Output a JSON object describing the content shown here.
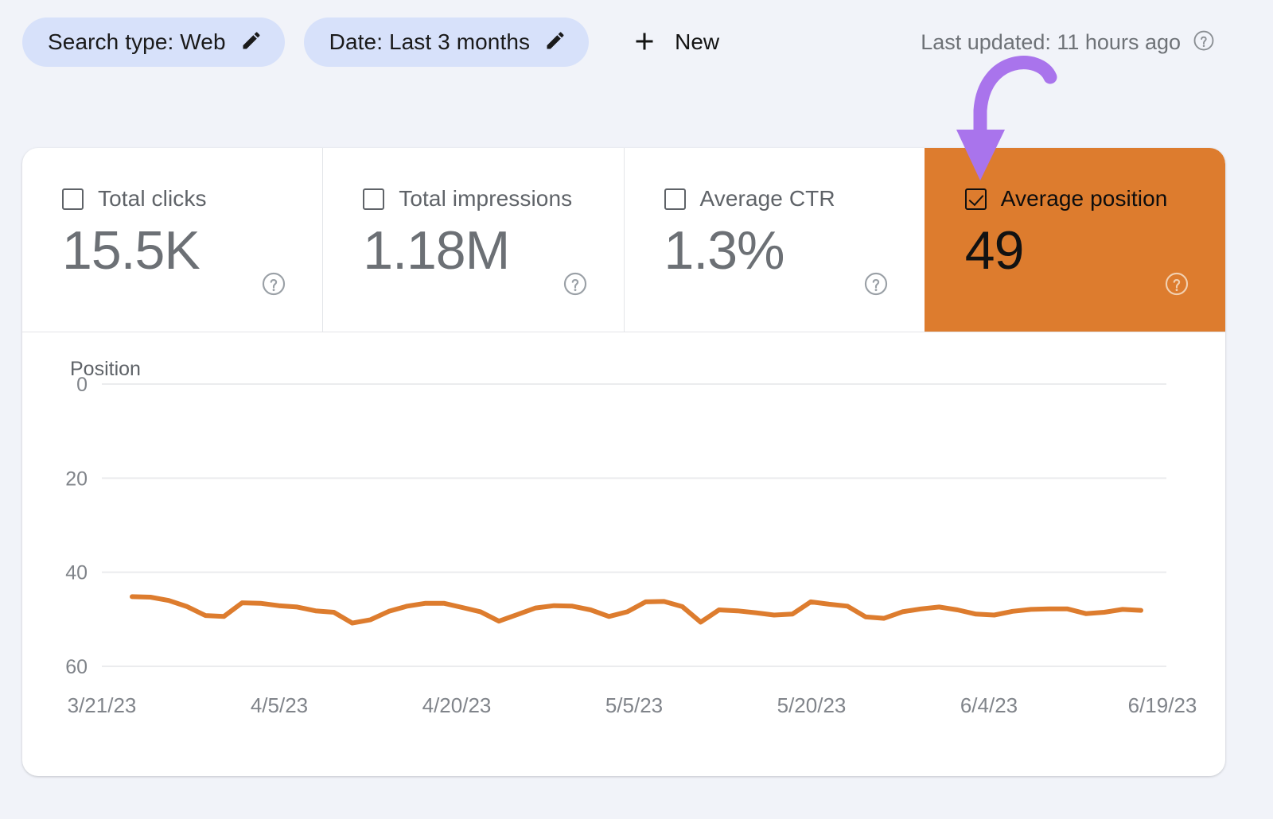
{
  "toolbar": {
    "search_type_chip": "Search type: Web",
    "date_chip": "Date: Last 3 months",
    "new_label": "New",
    "last_updated": "Last updated: 11 hours ago",
    "pencil_icon": "pencil-icon",
    "plus_icon": "plus-icon",
    "help_icon": "help-circle-icon"
  },
  "metrics": [
    {
      "label": "Total clicks",
      "value": "15.5K",
      "checked": false,
      "selected": false
    },
    {
      "label": "Total impressions",
      "value": "1.18M",
      "checked": false,
      "selected": false
    },
    {
      "label": "Average CTR",
      "value": "1.3%",
      "checked": false,
      "selected": false
    },
    {
      "label": "Average position",
      "value": "49",
      "checked": true,
      "selected": true
    }
  ],
  "annotation": {
    "type": "curved-down-arrow",
    "color": "#A974EC",
    "points_to": "Average position"
  },
  "colors": {
    "accent_orange": "#DD7C2E",
    "chip_blue": "#D7E1FA",
    "page_background": "#F1F3F9",
    "card_background": "#FFFFFF",
    "annotation_purple": "#A974EC",
    "muted_text": "#5F6368"
  },
  "chart_data": {
    "type": "line",
    "title": "",
    "xlabel": "",
    "ylabel": "Position",
    "ylim": [
      0,
      60
    ],
    "yticks": [
      0,
      20,
      40,
      60
    ],
    "y_inverted": true,
    "grid": true,
    "legend": false,
    "line_color": "#DD7C2E",
    "xtick_labels": [
      "3/21/23",
      "4/5/23",
      "4/20/23",
      "5/5/23",
      "5/20/23",
      "6/4/23",
      "6/19/23"
    ],
    "series": [
      {
        "name": "Average position",
        "values": [
          45.2,
          45.3,
          46.0,
          47.3,
          49.2,
          49.4,
          46.5,
          46.6,
          47.1,
          47.4,
          48.2,
          48.5,
          50.8,
          50.1,
          48.3,
          47.2,
          46.6,
          46.6,
          47.5,
          48.4,
          50.4,
          49.0,
          47.6,
          47.1,
          47.2,
          48.0,
          49.4,
          48.4,
          46.3,
          46.2,
          47.3,
          50.6,
          48.0,
          48.2,
          48.6,
          49.1,
          48.9,
          46.3,
          46.8,
          47.2,
          49.5,
          49.8,
          48.4,
          47.8,
          47.4,
          48.0,
          48.9,
          49.1,
          48.3,
          47.9,
          47.8,
          47.8,
          48.8,
          48.5,
          47.9,
          48.1
        ]
      }
    ]
  }
}
